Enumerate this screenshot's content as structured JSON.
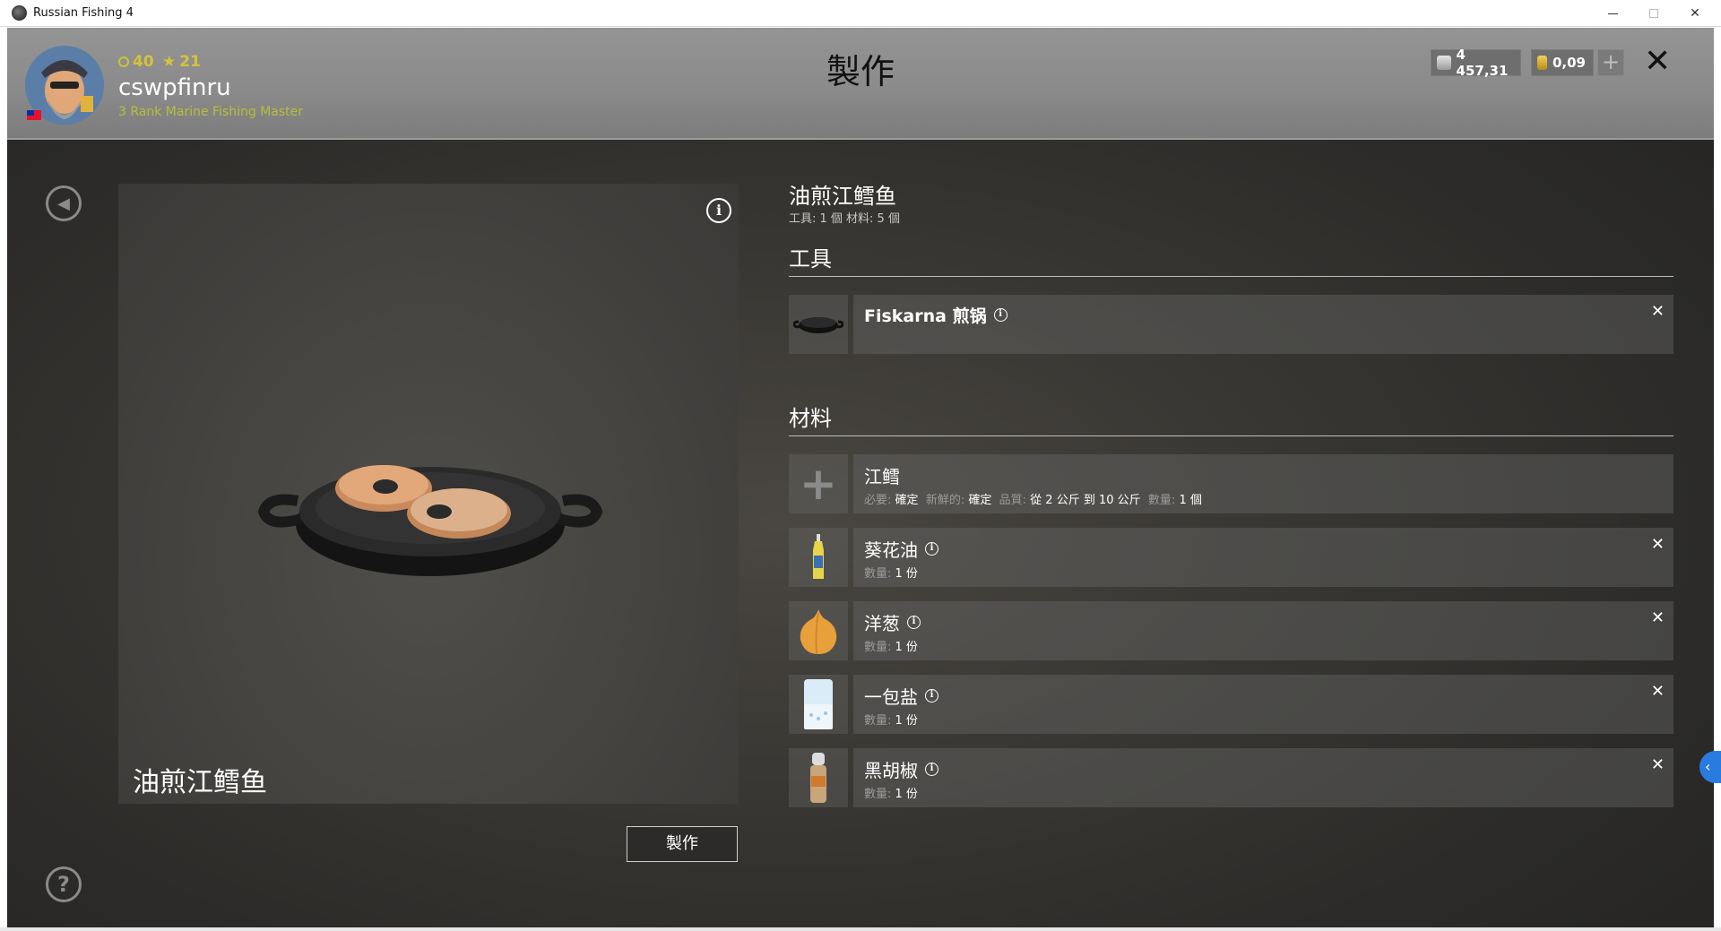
{
  "window": {
    "title": "Russian Fishing 4",
    "minimize_icon": "minimize-icon",
    "maximize_icon": "maximize-icon",
    "close_label": "✕"
  },
  "header": {
    "level": "40",
    "stars": "21",
    "username": "cswpfinru",
    "rank": "3 Rank Marine Fishing Master",
    "title": "製作",
    "silver": "4 457,31",
    "gold": "0,09",
    "add_label": "+",
    "close_label": "✕"
  },
  "preview": {
    "name": "油煎江鳕鱼",
    "craft_label": "製作",
    "info_label": "i",
    "help_label": "?"
  },
  "recipe": {
    "title": "油煎江鳕鱼",
    "summary": "工具: 1 個   材料: 5 個"
  },
  "sections": {
    "tools": "工具",
    "materials": "材料"
  },
  "tools": [
    {
      "name": "Fiskarna 煎锅",
      "icon": "frying-pan-icon"
    }
  ],
  "materials": [
    {
      "name": "江鳕",
      "meta_parts": [
        {
          "label": "必要:",
          "value": "確定"
        },
        {
          "label": "新鮮的:",
          "value": "確定"
        },
        {
          "label": "品質:",
          "value": "從 2 公斤 到 10 公斤"
        },
        {
          "label": "數量:",
          "value": "1 個"
        }
      ],
      "icon": "add-icon"
    },
    {
      "name": "葵花油",
      "meta_label": "數量:",
      "meta_value": "1 份",
      "icon": "oil-bottle-icon"
    },
    {
      "name": "洋葱",
      "meta_label": "數量:",
      "meta_value": "1 份",
      "icon": "onion-icon"
    },
    {
      "name": "一包盐",
      "meta_label": "數量:",
      "meta_value": "1 份",
      "icon": "salt-pack-icon"
    },
    {
      "name": "黑胡椒",
      "meta_label": "數量:",
      "meta_value": "1 份",
      "icon": "pepper-grinder-icon"
    }
  ],
  "remove_label": "✕",
  "colors": {
    "header_bg": "#8a8a8a",
    "accent_yellow": "#d6c23a",
    "rank_green": "#b7bf3a"
  }
}
